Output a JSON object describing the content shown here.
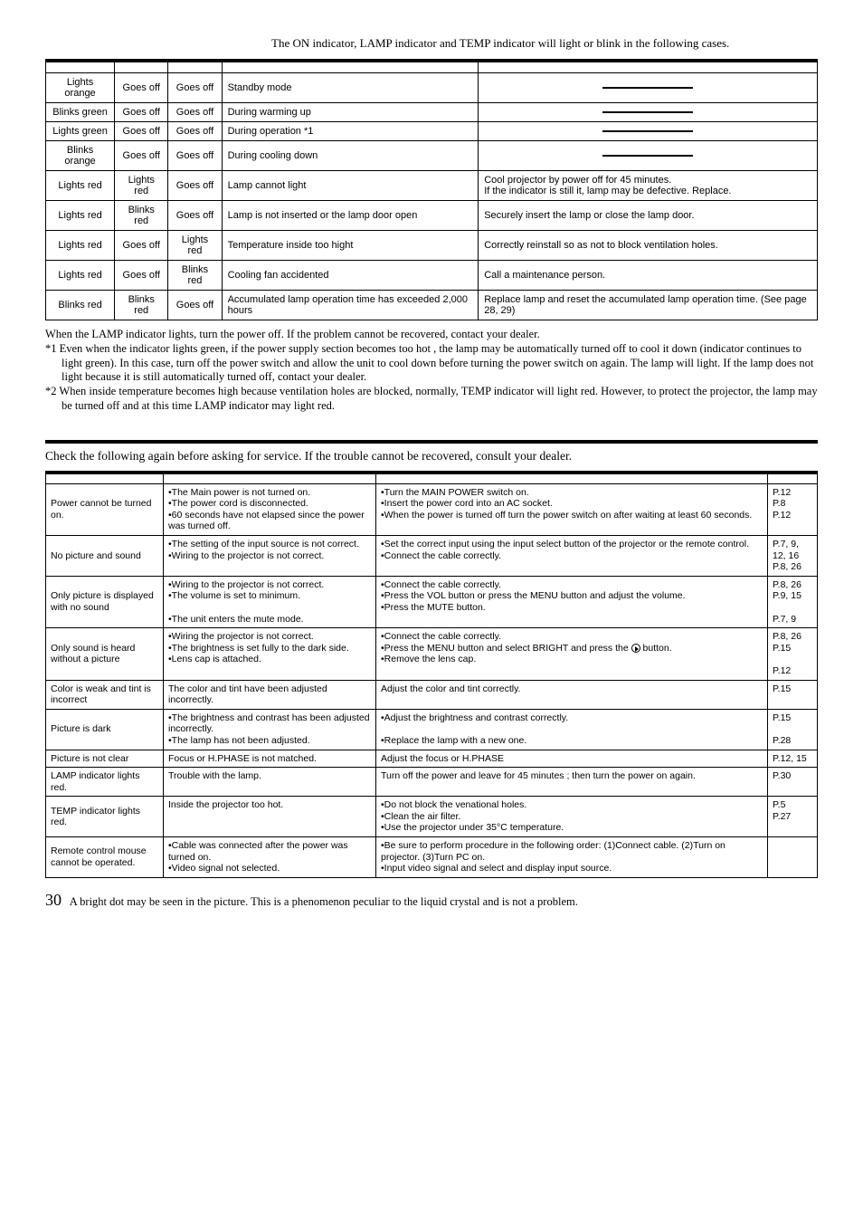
{
  "intro": "The ON indicator, LAMP indicator and TEMP indicator will light or blink in the following cases.",
  "table1_rows": [
    {
      "c1": "Lights orange",
      "c2": "Goes off",
      "c3": "Goes off",
      "c4": "Standby mode",
      "c5": "—",
      "dash": true
    },
    {
      "c1": "Blinks green",
      "c2": "Goes off",
      "c3": "Goes off",
      "c4": "During warming up",
      "c5": "—",
      "dash": true
    },
    {
      "c1": "Lights green",
      "c2": "Goes off",
      "c3": "Goes off",
      "c4": "During operation *1",
      "c5": "—",
      "dash": true
    },
    {
      "c1": "Blinks orange",
      "c2": "Goes off",
      "c3": "Goes off",
      "c4": "During cooling down",
      "c5": "—",
      "dash": true
    },
    {
      "c1": "Lights red",
      "c2": "Lights red",
      "c3": "Goes off",
      "c4": "Lamp cannot light",
      "c5": "Cool projector by power off for 45 minutes.\nIf the indicator is still it, lamp may be defective. Replace."
    },
    {
      "c1": "Lights red",
      "c2": "Blinks red",
      "c3": "Goes off",
      "c4": "Lamp is not inserted or the lamp door open",
      "c5": "Securely insert the lamp or close the lamp door."
    },
    {
      "c1": "Lights red",
      "c2": "Goes off",
      "c3": "Lights red",
      "c4": "Temperature inside too hight",
      "c5": "Correctly reinstall so as not to block ventilation holes."
    },
    {
      "c1": "Lights red",
      "c2": "Goes off",
      "c3": "Blinks red",
      "c4": "Cooling fan accidented",
      "c5": "Call a maintenance person."
    },
    {
      "c1": "Blinks red",
      "c2": "Blinks red",
      "c3": "Goes off",
      "c4": "Accumulated lamp operation time has exceeded 2,000 hours",
      "c5": "Replace lamp and reset the accumulated lamp operation time. (See page 28, 29)"
    }
  ],
  "notes": [
    "When the LAMP indicator lights, turn the power off. If the problem cannot be recovered, contact your dealer.",
    "*1 Even when the indicator lights green, if the power supply section becomes too hot , the lamp may be automatically turned off to cool it down (indicator continues to light green). In this case, turn off the power switch and allow the unit to cool down before turning the power switch on again. The lamp will light. If the lamp does not light because it is still automatically turned off, contact your dealer.",
    "*2 When inside temperature becomes high because ventilation holes are blocked, normally, TEMP indicator will light red.  However, to protect the projector, the lamp may be turned off and at this time LAMP indicator may light red."
  ],
  "check_intro": "Check the following again before asking for service. If the trouble cannot be recovered, consult your dealer.",
  "table2_rows": [
    {
      "symptom": "Power cannot be turned on.",
      "cause": "•The Main power is not turned on.\n•The power cord is disconnected.\n•60 seconds have not elapsed since the power was turned off.",
      "remedy": "•Turn the MAIN POWER switch on.\n•Insert the power cord into an AC socket.\n•When the power is turned off turn the power switch on after waiting at least 60 seconds.",
      "page": "P.12\nP.8\nP.12"
    },
    {
      "symptom": "No picture and sound",
      "cause": "•The setting of the input source is not correct.\n•Wiring to the projector is not correct.",
      "remedy": "•Set the correct input using the input select button of the projector or the remote control.\n•Connect the cable correctly.",
      "page": "P.7, 9, 12, 16\nP.8, 26"
    },
    {
      "symptom": "Only picture is displayed with no sound",
      "cause": "•Wiring to the projector is not correct.\n•The volume is set to minimum.\n\n•The unit enters the mute mode.",
      "remedy": "•Connect the cable correctly.\n•Press the VOL button or press the MENU button and adjust the volume.\n•Press the MUTE button.",
      "page": "P.8, 26\nP.9, 15\n\nP.7, 9"
    },
    {
      "symptom": "Only sound is heard without a picture",
      "cause": "•Wiring the projector is not correct.\n•The brightness is set fully to the dark side.\n•Lens cap is attached.",
      "remedy_html": true,
      "remedy": "•Connect the cable correctly.\n•Press the MENU button and select BRIGHT and press the (▶) button.\n•Remove the lens cap.",
      "page": "P.8, 26\nP.15\n\nP.12"
    },
    {
      "symptom": "Color is weak and tint is incorrect",
      "cause": "The color and tint have been adjusted incorrectly.",
      "remedy": "Adjust the color and tint correctly.",
      "page": "P.15"
    },
    {
      "symptom": "Picture is dark",
      "cause": "•The brightness and contrast has been adjusted incorrectly.\n•The lamp has not been adjusted.",
      "remedy": "•Adjust the brightness and contrast correctly.\n\n•Replace the lamp with a new one.",
      "page": "P.15\n\nP.28"
    },
    {
      "symptom": "Picture is not clear",
      "cause": "Focus or H.PHASE is not matched.",
      "remedy": "Adjust the focus or H.PHASE",
      "page": "P.12, 15"
    },
    {
      "symptom": "LAMP indicator lights red.",
      "cause": "Trouble with the lamp.",
      "remedy": "Turn off the power and leave for 45 minutes ; then turn the power on again.",
      "page": "P.30"
    },
    {
      "symptom": "TEMP indicator lights red.",
      "cause": "Inside the projector too hot.",
      "remedy": "•Do not block the venational holes.\n•Clean the air filter.\n•Use the projector under 35°C temperature.",
      "page": "P.5\nP.27"
    },
    {
      "symptom": "Remote control mouse cannot be operated.",
      "cause": "•Cable was connected after the power was turned on.\n•Video signal not selected.",
      "remedy": "•Be sure to perform procedure in the following order: (1)Connect cable. (2)Turn on projector. (3)Turn PC on.\n•Input video signal and select and display input source.",
      "page": ""
    }
  ],
  "footer_note": "A bright dot may be seen in the picture.  This is a phenomenon peculiar to the liquid crystal and is not a problem.",
  "page_number": "30"
}
